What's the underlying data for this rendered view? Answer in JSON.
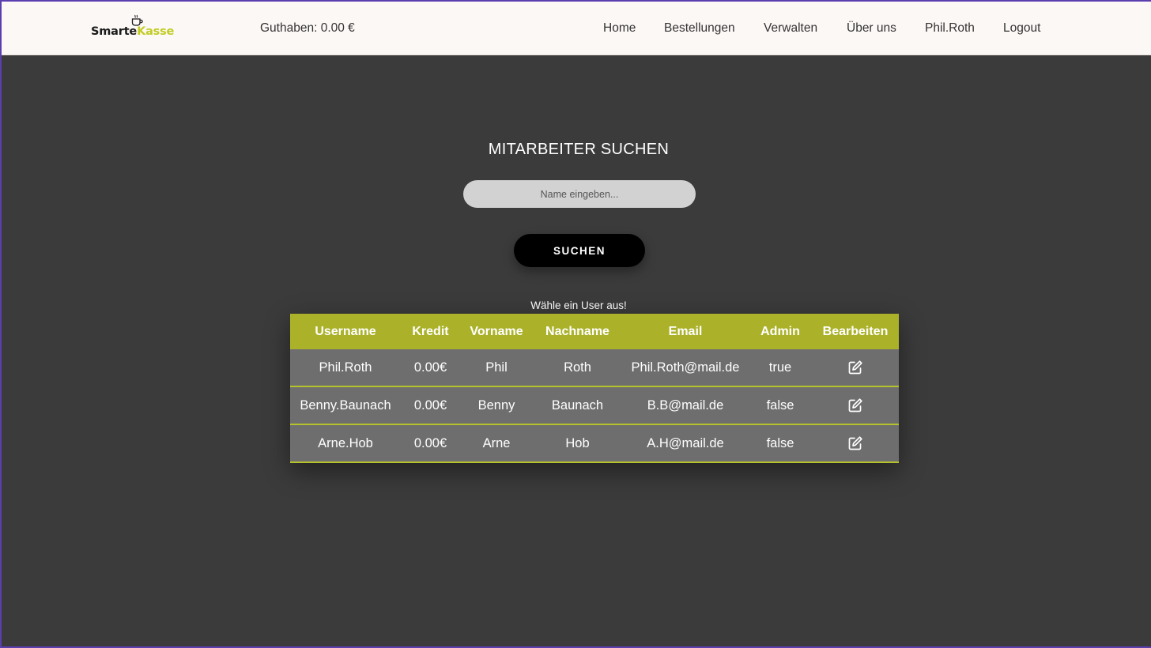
{
  "header": {
    "logo": {
      "part1": "Smarte",
      "part2": "Kasse",
      "icon": "coffee-cup-icon"
    },
    "credit": "Guthaben: 0.00 €",
    "nav": [
      "Home",
      "Bestellungen",
      "Verwalten",
      "Über uns",
      "Phil.Roth",
      "Logout"
    ]
  },
  "main": {
    "title": "MITARBEITER SUCHEN",
    "search_placeholder": "Name eingeben...",
    "search_button": "SUCHEN",
    "hint": "Wähle ein User aus!"
  },
  "table": {
    "columns": [
      "Username",
      "Kredit",
      "Vorname",
      "Nachname",
      "Email",
      "Admin",
      "Bearbeiten"
    ],
    "rows": [
      [
        "Phil.Roth",
        "0.00€",
        "Phil",
        "Roth",
        "Phil.Roth@mail.de",
        "true"
      ],
      [
        "Benny.Baunach",
        "0.00€",
        "Benny",
        "Baunach",
        "B.B@mail.de",
        "false"
      ],
      [
        "Arne.Hob",
        "0.00€",
        "Arne",
        "Hob",
        "A.H@mail.de",
        "false"
      ]
    ],
    "edit_icon": "edit-icon"
  },
  "colors": {
    "header_bg": "#fcf8f6",
    "page_bg": "#3b3b3b",
    "accent": "#abb22a",
    "row_bg": "#6e6e6e",
    "logo_accent": "#c2cc24"
  }
}
